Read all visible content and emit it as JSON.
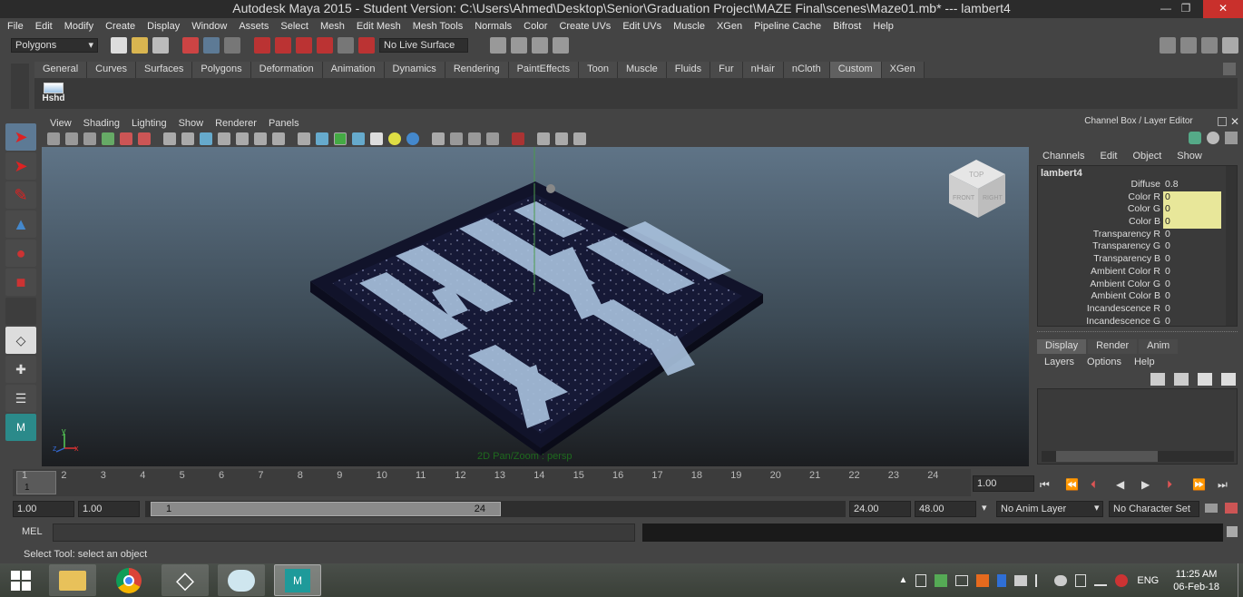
{
  "title": "Autodesk Maya 2015 - Student Version: C:\\Users\\Ahmed\\Desktop\\Senior\\Graduation Project\\MAZE Final\\scenes\\Maze01.mb*   ---    lambert4",
  "window_controls": {
    "minimize": "—",
    "restore": "❐",
    "close": "✕"
  },
  "menubar": [
    "File",
    "Edit",
    "Modify",
    "Create",
    "Display",
    "Window",
    "Assets",
    "Select",
    "Mesh",
    "Edit Mesh",
    "Mesh Tools",
    "Normals",
    "Color",
    "Create UVs",
    "Edit UVs",
    "Muscle",
    "XGen",
    "Pipeline Cache",
    "Bifrost",
    "Help"
  ],
  "status": {
    "mode": "Polygons",
    "live_surface": "No Live Surface"
  },
  "shelf": {
    "tabs": [
      "General",
      "Curves",
      "Surfaces",
      "Polygons",
      "Deformation",
      "Animation",
      "Dynamics",
      "Rendering",
      "PaintEffects",
      "Toon",
      "Muscle",
      "Fluids",
      "Fur",
      "nHair",
      "nCloth",
      "Custom",
      "XGen"
    ],
    "active_tab": "Custom",
    "button_label": "Hshd"
  },
  "viewport": {
    "menu": [
      "View",
      "Shading",
      "Lighting",
      "Show",
      "Renderer",
      "Panels"
    ],
    "hud": "2D Pan/Zoom : persp",
    "viewcube": {
      "top": "TOP",
      "front": "FRONT",
      "right": "RIGHT"
    },
    "axis": {
      "y": "y",
      "x": "x",
      "z": "z"
    }
  },
  "channel_box": {
    "header": "Channel Box / Layer Editor",
    "menu": [
      "Channels",
      "Edit",
      "Object",
      "Show"
    ],
    "node": "lambert4",
    "attributes": [
      {
        "name": "Diffuse",
        "value": "0.8",
        "highlight": false
      },
      {
        "name": "Color R",
        "value": "0",
        "highlight": true
      },
      {
        "name": "Color G",
        "value": "0",
        "highlight": true
      },
      {
        "name": "Color B",
        "value": "0",
        "highlight": true
      },
      {
        "name": "Transparency R",
        "value": "0",
        "highlight": false
      },
      {
        "name": "Transparency G",
        "value": "0",
        "highlight": false
      },
      {
        "name": "Transparency B",
        "value": "0",
        "highlight": false
      },
      {
        "name": "Ambient Color R",
        "value": "0",
        "highlight": false
      },
      {
        "name": "Ambient Color G",
        "value": "0",
        "highlight": false
      },
      {
        "name": "Ambient Color B",
        "value": "0",
        "highlight": false
      },
      {
        "name": "Incandescence R",
        "value": "0",
        "highlight": false
      },
      {
        "name": "Incandescence G",
        "value": "0",
        "highlight": false
      }
    ]
  },
  "layer_editor": {
    "tabs": [
      "Display",
      "Render",
      "Anim"
    ],
    "active_tab": "Display",
    "menu": [
      "Layers",
      "Options",
      "Help"
    ]
  },
  "timeline": {
    "ticks": [
      "1",
      "2",
      "3",
      "4",
      "5",
      "6",
      "7",
      "8",
      "9",
      "10",
      "11",
      "12",
      "13",
      "14",
      "15",
      "16",
      "17",
      "18",
      "19",
      "20",
      "21",
      "22",
      "23",
      "24"
    ],
    "current_frame": "1",
    "current_time": "1.00"
  },
  "range": {
    "start_time": "1.00",
    "playback_start": "1.00",
    "slider_start": "1",
    "slider_end": "24",
    "playback_end": "24.00",
    "end_time": "48.00",
    "anim_layer": "No Anim Layer",
    "character_set": "No Character Set"
  },
  "command_line": {
    "label": "MEL"
  },
  "help_line": "Select Tool: select an object",
  "taskbar": {
    "language": "ENG",
    "time": "11:25 AM",
    "date": "06-Feb-18"
  },
  "colors": {
    "bg": "#444444",
    "field_highlight": "#e8e79a",
    "active_tool": "#5d7a95"
  }
}
